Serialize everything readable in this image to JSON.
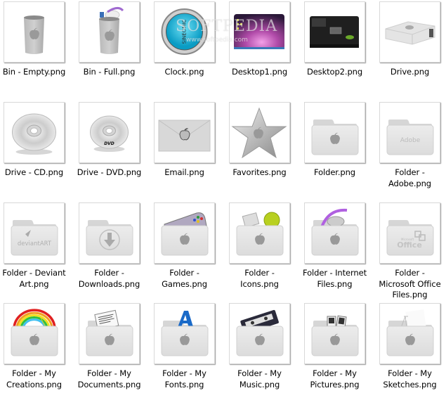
{
  "view": "large-icons",
  "watermark": {
    "title": "SOFTPEDIA",
    "url": "www.softpedia.com"
  },
  "items": [
    {
      "name": "Bin - Empty.png",
      "icon": "bin-empty-icon"
    },
    {
      "name": "Bin - Full.png",
      "icon": "bin-full-icon"
    },
    {
      "name": "Clock.png",
      "icon": "clock-icon"
    },
    {
      "name": "Desktop1.png",
      "icon": "desktop1-icon"
    },
    {
      "name": "Desktop2.png",
      "icon": "desktop2-icon"
    },
    {
      "name": "Drive.png",
      "icon": "drive-icon"
    },
    {
      "name": "Drive - CD.png",
      "icon": "cd-icon"
    },
    {
      "name": "Drive - DVD.png",
      "icon": "dvd-icon"
    },
    {
      "name": "Email.png",
      "icon": "email-icon"
    },
    {
      "name": "Favorites.png",
      "icon": "star-icon"
    },
    {
      "name": "Folder.png",
      "icon": "folder-icon"
    },
    {
      "name": "Folder - Adobe.png",
      "icon": "folder-adobe-icon"
    },
    {
      "name": "Folder - Deviant Art.png",
      "icon": "folder-deviantart-icon"
    },
    {
      "name": "Folder - Downloads.png",
      "icon": "folder-downloads-icon"
    },
    {
      "name": "Folder - Games.png",
      "icon": "folder-games-icon"
    },
    {
      "name": "Folder - Icons.png",
      "icon": "folder-icons-icon"
    },
    {
      "name": "Folder - Internet Files.png",
      "icon": "folder-internet-icon"
    },
    {
      "name": "Folder - Microsoft Office Files.png",
      "icon": "folder-office-icon"
    },
    {
      "name": "Folder - My Creations.png",
      "icon": "folder-creations-icon"
    },
    {
      "name": "Folder - My Documents.png",
      "icon": "folder-documents-icon"
    },
    {
      "name": "Folder - My Fonts.png",
      "icon": "folder-fonts-icon"
    },
    {
      "name": "Folder - My Music.png",
      "icon": "folder-music-icon"
    },
    {
      "name": "Folder - My Pictures.png",
      "icon": "folder-pictures-icon"
    },
    {
      "name": "Folder - My Sketches.png",
      "icon": "folder-sketches-icon"
    }
  ],
  "glyph_text": {
    "clock": "SINEOMIC",
    "dvd": "DVD",
    "adobe": "Adobe",
    "deviantart": "deviantART",
    "office_small": "Microsoft",
    "office": "Office"
  }
}
